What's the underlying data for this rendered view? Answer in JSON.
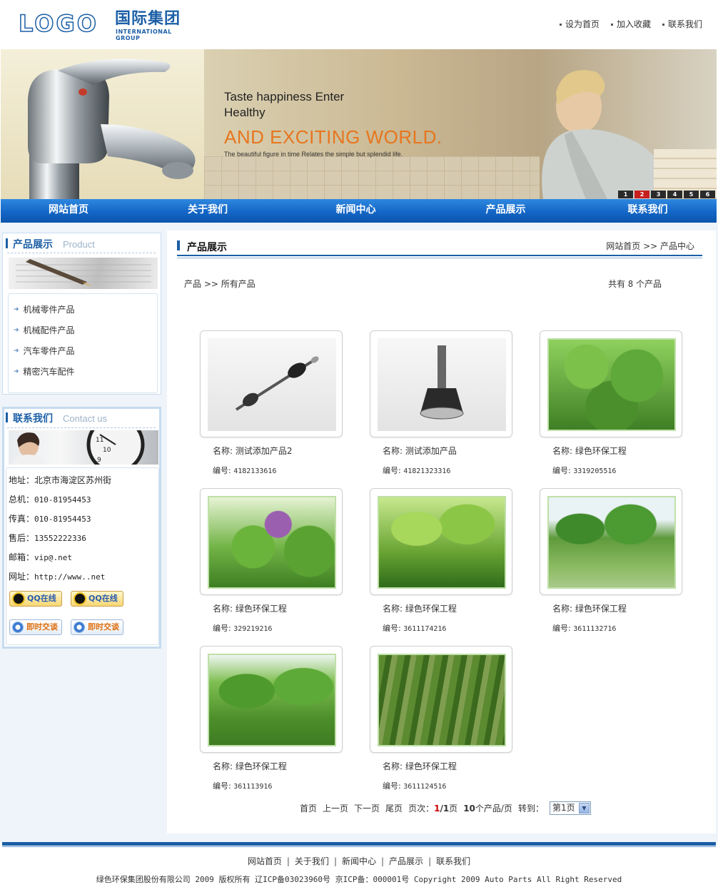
{
  "header": {
    "logo_mark": "LOGO",
    "logo_cn": "国际集团",
    "logo_en": "INTERNATIONAL GROUP",
    "links": [
      "设为首页",
      "加入收藏",
      "联系我们"
    ]
  },
  "banner": {
    "line1": "Taste happiness Enter",
    "line2": "Healthy",
    "line3": "AND EXCITING WORLD.",
    "line4": "The beautiful figure in time Relates the simple but splendid life.",
    "pages": [
      "1",
      "2",
      "3",
      "4",
      "5",
      "6"
    ],
    "active_page": "2"
  },
  "nav": {
    "items": [
      "网站首页",
      "关于我们",
      "新闻中心",
      "产品展示",
      "联系我们"
    ]
  },
  "sidebar": {
    "products": {
      "title_cn": "产品展示",
      "title_en": "Product",
      "items": [
        "机械零件产品",
        "机械配件产品",
        "汽车零件产品",
        "精密汽车配件"
      ]
    },
    "contact": {
      "title_cn": "联系我们",
      "title_en": "Contact us",
      "address_label": "地址：",
      "address": "北京市海淀区苏州街",
      "phone_label": "总机：",
      "phone": "010-81954453",
      "fax_label": "传真：",
      "fax": "010-81954453",
      "service_label": "售后：",
      "service": "13552222336",
      "email_label": "邮箱：",
      "email": "vip@.net",
      "web_label": "网址：",
      "web": "http://www..net",
      "qq_label": "QQ在线",
      "chat_label": "即时交谈"
    }
  },
  "content": {
    "title": "产品展示",
    "breadcrumb": "网站首页 >> 产品中心",
    "sub_crumb": "产品 >> 所有产品",
    "count_prefix": "共有",
    "count": "8",
    "count_suffix": "个产品",
    "name_label": "名称:",
    "code_label": "编号:",
    "products": [
      {
        "name": "测试添加产品2",
        "code": "4182133616"
      },
      {
        "name": "测试添加产品",
        "code": "41821323316"
      },
      {
        "name": "绿色环保工程",
        "code": "3319205516"
      },
      {
        "name": "绿色环保工程",
        "code": "329219216"
      },
      {
        "name": "绿色环保工程",
        "code": "3611174216"
      },
      {
        "name": "绿色环保工程",
        "code": "3611132716"
      },
      {
        "name": "绿色环保工程",
        "code": "361113916"
      },
      {
        "name": "绿色环保工程",
        "code": "3611124516"
      }
    ],
    "pager": {
      "first": "首页",
      "prev": "上一页",
      "next": "下一页",
      "last": "尾页",
      "page_label": "页次：",
      "current": "1",
      "total": "/1",
      "page_suffix": "页",
      "per_page": "10",
      "per_page_suffix": "个产品/页",
      "goto": "转到：",
      "select_value": "第1页"
    }
  },
  "footer": {
    "links": [
      "网站首页",
      "关于我们",
      "新闻中心",
      "产品展示",
      "联系我们"
    ],
    "copyright": "绿色环保集团股份有限公司 2009 版权所有 辽ICP备03023960号 京ICP备：000001号 Copyright 2009 Auto Parts All Right Reserved"
  }
}
